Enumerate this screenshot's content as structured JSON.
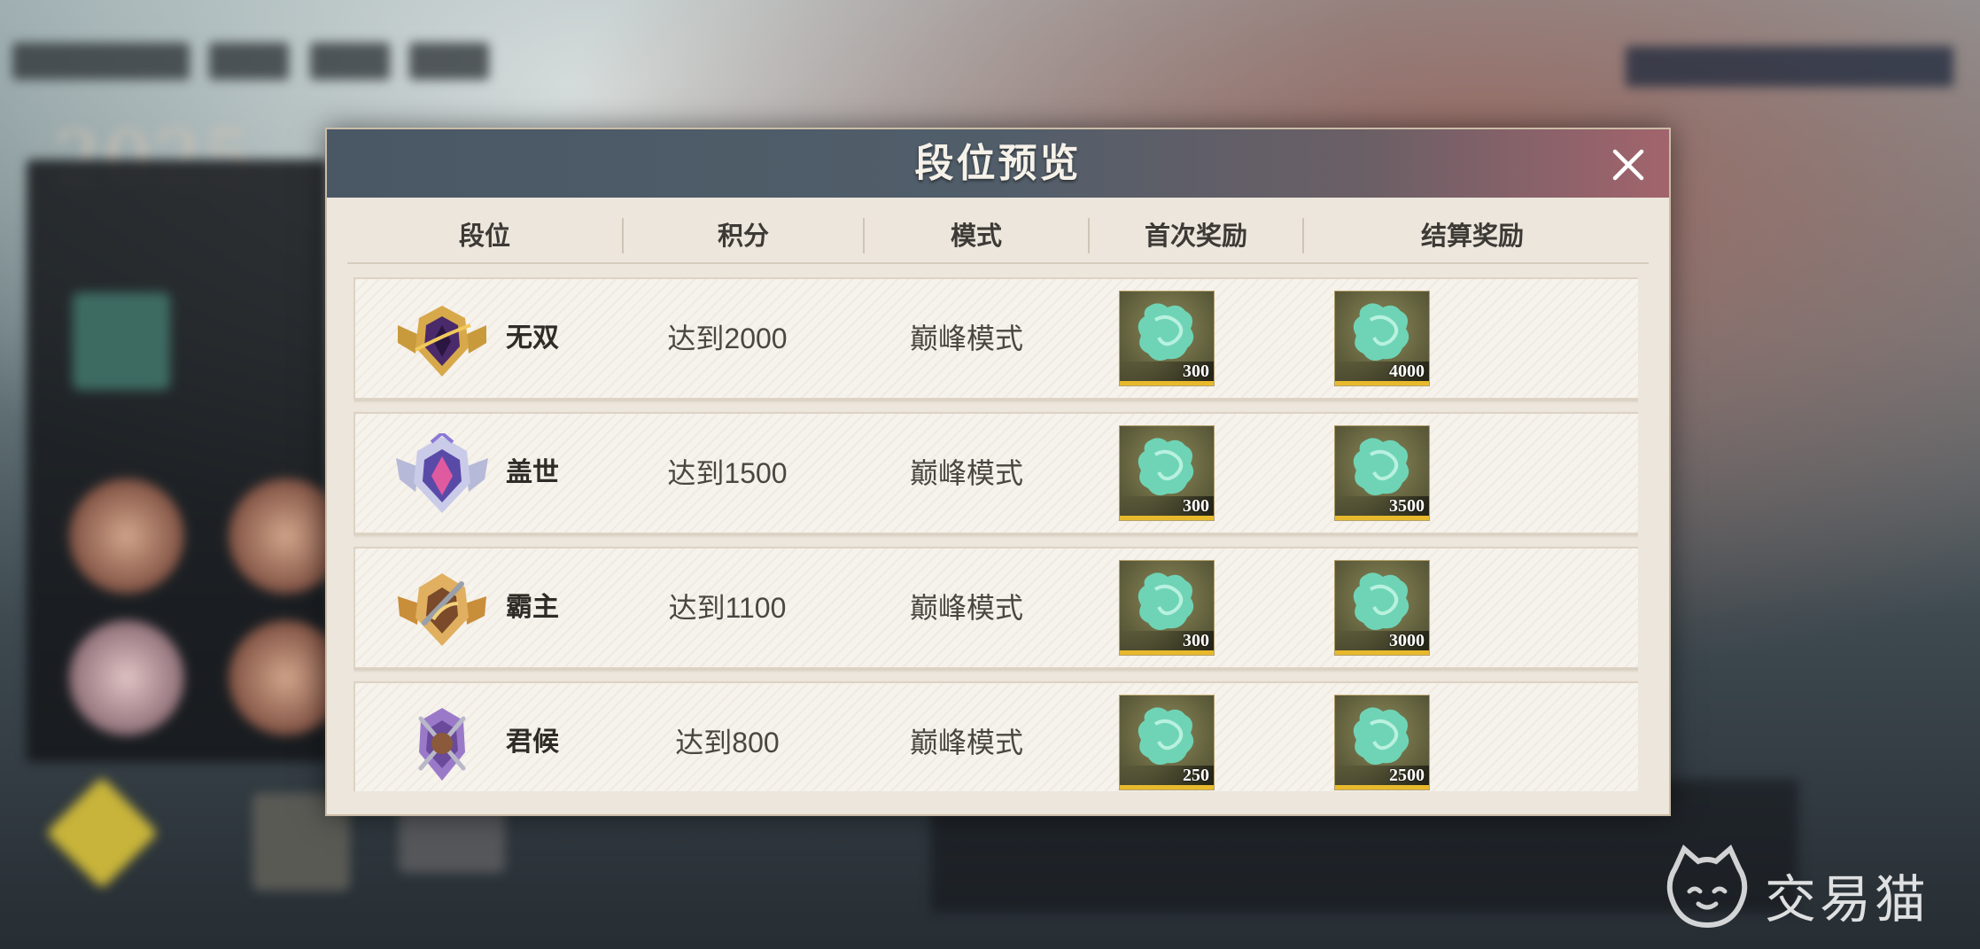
{
  "modal": {
    "title": "段位预览",
    "columns": [
      "段位",
      "积分",
      "模式",
      "首次奖励",
      "结算奖励"
    ]
  },
  "rows": [
    {
      "rank": "无双",
      "score": "达到2000",
      "mode": "巅峰模式",
      "first_reward": "300",
      "settle_reward": "4000",
      "emblem_color": "#4a2a6a"
    },
    {
      "rank": "盖世",
      "score": "达到1500",
      "mode": "巅峰模式",
      "first_reward": "300",
      "settle_reward": "3500",
      "emblem_color": "#5a4aa8"
    },
    {
      "rank": "霸主",
      "score": "达到1100",
      "mode": "巅峰模式",
      "first_reward": "300",
      "settle_reward": "3000",
      "emblem_color": "#b07a2a"
    },
    {
      "rank": "君候",
      "score": "达到800",
      "mode": "巅峰模式",
      "first_reward": "250",
      "settle_reward": "2500",
      "emblem_color": "#6a4a9a"
    }
  ],
  "background": {
    "year_text": "2025",
    "tabs": [
      "",
      "",
      "",
      ""
    ]
  },
  "watermark": {
    "text": "交易猫",
    "icon": "cat-logo-icon"
  },
  "colors": {
    "header_left": "#4a5866",
    "header_right": "#a2646c",
    "modal_bg": "#ece6dc",
    "gem": "#6fd4b6",
    "reward_bar": "#e8b92c"
  }
}
